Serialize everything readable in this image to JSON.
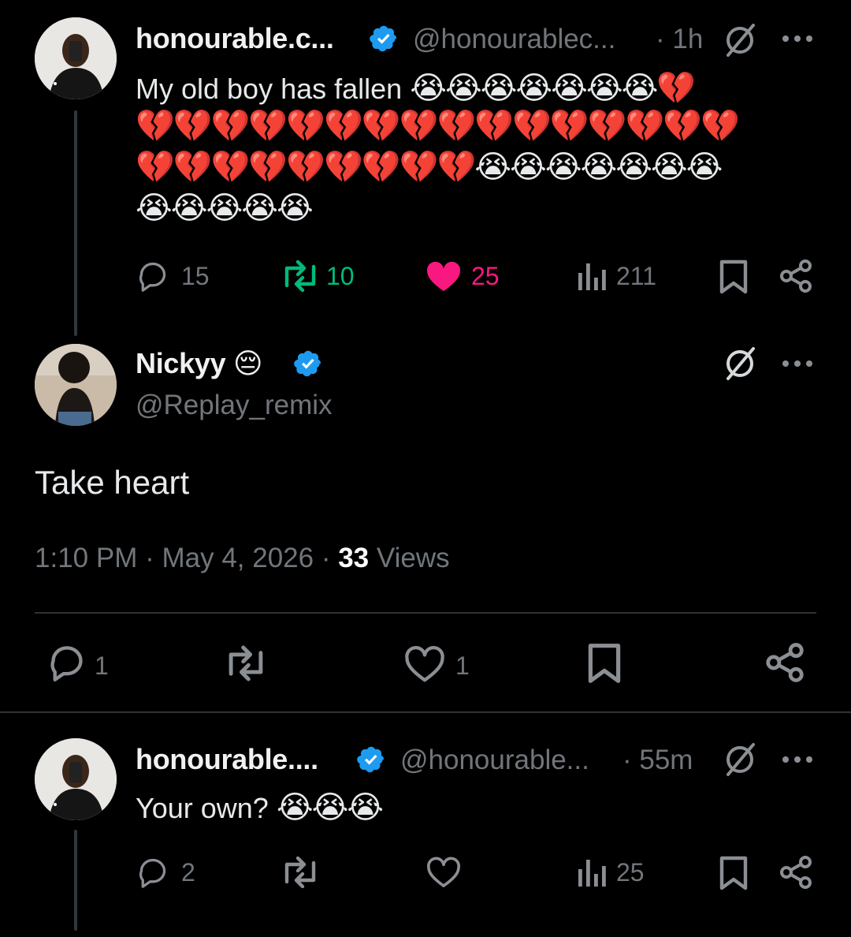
{
  "tweet1": {
    "name": "honourable.c...",
    "handle": "@honourablec...",
    "time": "· 1h",
    "text": "My old boy has fallen",
    "emoji_line1": "😭😭😭😭😭😭😭💔",
    "emoji_line2": "💔💔💔💔💔💔💔💔💔💔💔💔💔💔💔💔",
    "emoji_line3": "💔💔💔💔💔💔💔💔💔😭😭😭😭😭😭😭",
    "emoji_line4": "😭😭😭😭😭",
    "replies": "15",
    "reposts": "10",
    "likes": "25",
    "views": "211",
    "colors": {
      "repost_active": "#00ba7c",
      "like_active": "#f91880"
    }
  },
  "tweet2": {
    "name": "Nickyy",
    "name_emoji": "😔",
    "handle": "@Replay_remix",
    "text": "Take heart",
    "time": "1:10 PM",
    "date": "May 4, 2026",
    "views_count": "33",
    "views_label": "Views",
    "replies": "1",
    "likes": "1"
  },
  "tweet3": {
    "name": "honourable....",
    "handle": "@honourable...",
    "time": "· 55m",
    "text": "Your own?",
    "emoji": "😭😭😭",
    "replies": "2",
    "views": "25"
  },
  "colors": {
    "verified": "#1d9bf0",
    "muted": "#71767b",
    "background": "#000000"
  }
}
